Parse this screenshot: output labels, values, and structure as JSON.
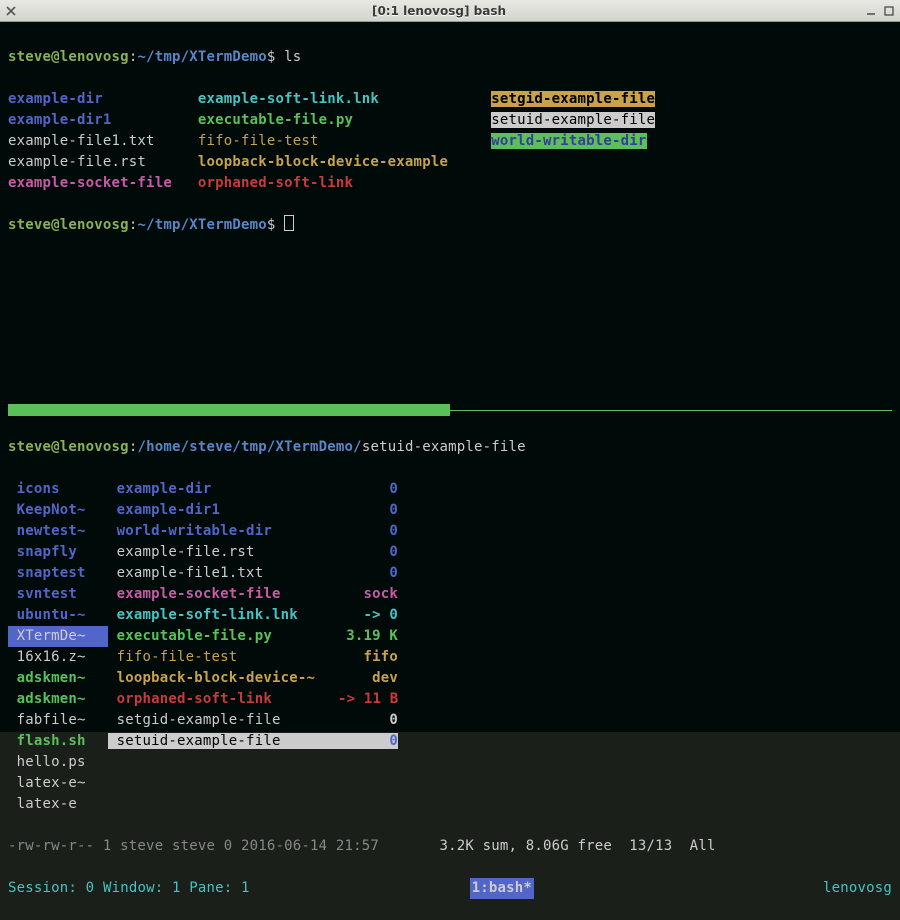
{
  "window": {
    "title": "[0:1 lenovosg] bash"
  },
  "top_prompt": {
    "user": "steve@lenovosg",
    "path": "~/tmp/XTermDemo",
    "sep": "$",
    "cmd": "ls"
  },
  "ls": {
    "c1": [
      {
        "cls": "dir",
        "t": "example-dir"
      },
      {
        "cls": "dir",
        "t": "example-dir1"
      },
      {
        "cls": "plain",
        "t": "example-file1.txt"
      },
      {
        "cls": "plain",
        "t": "example-file.rst"
      },
      {
        "cls": "socket",
        "t": "example-socket-file"
      }
    ],
    "c2": [
      {
        "cls": "symlink",
        "t": "example-soft-link.lnk"
      },
      {
        "cls": "exec",
        "t": "executable-file.py"
      },
      {
        "cls": "fifo",
        "t": "fifo-file-test"
      },
      {
        "cls": "block",
        "t": "loopback-block-device-example"
      },
      {
        "cls": "orphan",
        "t": "orphaned-soft-link"
      }
    ],
    "c3": [
      {
        "cls": "setgid",
        "t": "setgid-example-file"
      },
      {
        "cls": "setuid",
        "t": "setuid-example-file"
      },
      {
        "cls": "ww",
        "t": "world-writable-dir"
      },
      {
        "cls": "",
        "t": ""
      },
      {
        "cls": "",
        "t": ""
      }
    ]
  },
  "mc": {
    "prompt_user": "steve@lenovosg",
    "prompt_path": "/home/steve/tmp/XTermDemo/",
    "prompt_file": "setuid-example-file",
    "left": [
      {
        "t": "icons",
        "c": "dir"
      },
      {
        "t": "KeepNot~",
        "c": "dir"
      },
      {
        "t": "newtest~",
        "c": "dir"
      },
      {
        "t": "snapfly",
        "c": "dir"
      },
      {
        "t": "snaptest",
        "c": "dir"
      },
      {
        "t": "svntest",
        "c": "dir"
      },
      {
        "t": "ubuntu-~",
        "c": "dir"
      },
      {
        "t": "XTermDe~",
        "c": "hl"
      },
      {
        "t": "16x16.z~",
        "c": "plain"
      },
      {
        "t": "adskmen~",
        "c": "ex"
      },
      {
        "t": "adskmen~",
        "c": "ex"
      },
      {
        "t": "fabfile~",
        "c": "plain"
      },
      {
        "t": "flash.sh",
        "c": "ex"
      },
      {
        "t": "hello.ps",
        "c": "plain"
      },
      {
        "t": "latex-e~",
        "c": "plain"
      },
      {
        "t": "latex-e",
        "c": "plain"
      }
    ],
    "right": [
      {
        "n": "example-dir",
        "nc": "dir",
        "s": "0",
        "sc": ""
      },
      {
        "n": "example-dir1",
        "nc": "dir",
        "s": "0",
        "sc": ""
      },
      {
        "n": "world-writable-dir",
        "nc": "dir",
        "s": "0",
        "sc": ""
      },
      {
        "n": "example-file.rst",
        "nc": "plain",
        "s": "0",
        "sc": ""
      },
      {
        "n": "example-file1.txt",
        "nc": "plain",
        "s": "0",
        "sc": ""
      },
      {
        "n": "example-socket-file",
        "nc": "socket",
        "s": "sock",
        "sc": "sock"
      },
      {
        "n": "example-soft-link.lnk",
        "nc": "symlink",
        "s": "-> 0",
        "sc": "sym"
      },
      {
        "n": "executable-file.py",
        "nc": "exec",
        "s": "3.19 K",
        "sc": "exec"
      },
      {
        "n": "fifo-file-test",
        "nc": "fifo",
        "s": "fifo",
        "sc": "fifo"
      },
      {
        "n": "loopback-block-device-~",
        "nc": "block",
        "s": "dev",
        "sc": "fifo"
      },
      {
        "n": "orphaned-soft-link",
        "nc": "orphan",
        "s": "-> 11 B",
        "sc": "orph"
      },
      {
        "n": "setgid-example-file",
        "nc": "plain",
        "s": "0",
        "sc": "plain"
      },
      {
        "n": "setuid-example-file",
        "nc": "sel",
        "s": "0",
        "sc": "sel"
      }
    ],
    "status": "-rw-rw-r-- 1 steve steve 0 2016-06-14 21:57",
    "status2": "3.2K sum, 8.06G free  13/13  All"
  },
  "tmux": {
    "session": "Session: 0",
    "window": "Window: 1",
    "pane": "Pane: 1",
    "cur": "1:bash*",
    "host": "lenovosg"
  }
}
